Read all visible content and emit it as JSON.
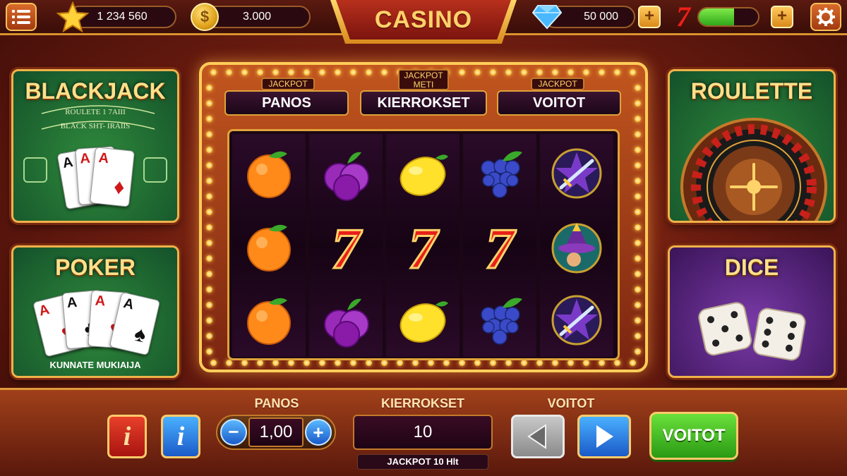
{
  "topbar": {
    "stars_value": "1 234 560",
    "coins_symbol": "$",
    "coins_value": "3.000",
    "title": "CASINO",
    "gems_value": "50 000",
    "plus_label": "+",
    "seven_symbol": "7",
    "energy_level": 0.6
  },
  "games": {
    "blackjack": {
      "title": "BLACKJACK",
      "felt_line1": "ROULETE 1 7AIII",
      "felt_line2": "BLACK SHT- IRAIIS",
      "cards": [
        {
          "rank": "A",
          "suit": "♠"
        },
        {
          "rank": "A",
          "suit": "♥"
        },
        {
          "rank": "A",
          "suit": "♦"
        }
      ]
    },
    "poker": {
      "title": "POKER",
      "subtitle": "KUNNATE MUKIAIJA",
      "cards": [
        {
          "rank": "A",
          "suit": "♥"
        },
        {
          "rank": "A",
          "suit": "♣"
        },
        {
          "rank": "A",
          "suit": "♥"
        },
        {
          "rank": "A",
          "suit": "♠"
        }
      ]
    },
    "roulette": {
      "title": "ROULETTE"
    },
    "dice": {
      "title": "DICE"
    }
  },
  "slot": {
    "tabs": [
      {
        "tag": "JACKPOT",
        "label": "PANOS"
      },
      {
        "tag": "JACKPOT METI",
        "label": "KIERROKSET"
      },
      {
        "tag": "JACKPOT",
        "label": "VOITOT"
      }
    ],
    "reels": [
      [
        "orange",
        "orange",
        "orange"
      ],
      [
        "plum",
        "seven",
        "plum"
      ],
      [
        "lemon",
        "seven",
        "lemon"
      ],
      [
        "grapes",
        "seven",
        "grapes"
      ],
      [
        "sword",
        "wizard",
        "sword"
      ]
    ],
    "seven_text": "7"
  },
  "controls": {
    "info_red": "i",
    "info_blue": "i",
    "bet_label": "PANOS",
    "bet_value": "1,00",
    "minus": "−",
    "plus": "+",
    "spins_label": "KIERROKSET",
    "spins_value": "10",
    "jackpot_text": "JACKPOT 10 Hlt",
    "wins_label": "VOITOT",
    "wins_button": "VOITOT"
  },
  "colors": {
    "gold": "#f0b24a",
    "felt": "#2f8a3c",
    "purple": "#7a3aa8",
    "win_green": "#3fb81a",
    "blue": "#2a8ae0"
  }
}
